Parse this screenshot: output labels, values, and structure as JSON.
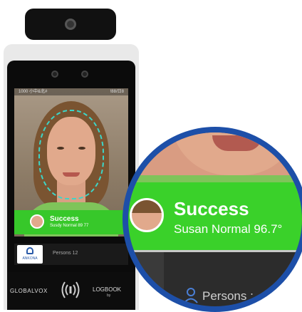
{
  "device": {
    "status_left": "1000 小中&北#",
    "status_right": "!88/日8"
  },
  "recognition": {
    "status": "Success",
    "name_small": "Susdy Normal 89 77",
    "name_zoom": "Susan Normal 96.7°"
  },
  "footer": {
    "org_logo": "ANKONA",
    "persons_small": "Persons 12",
    "persons_zoom": "Persons :",
    "brand_left": "GLOBALVOX",
    "brand_right": "LOGBOOK",
    "brand_right_sub": "by"
  },
  "colors": {
    "success_green": "#3ad12a",
    "magnifier_ring": "#1d4fa8",
    "face_outline": "#3cd6c8"
  }
}
